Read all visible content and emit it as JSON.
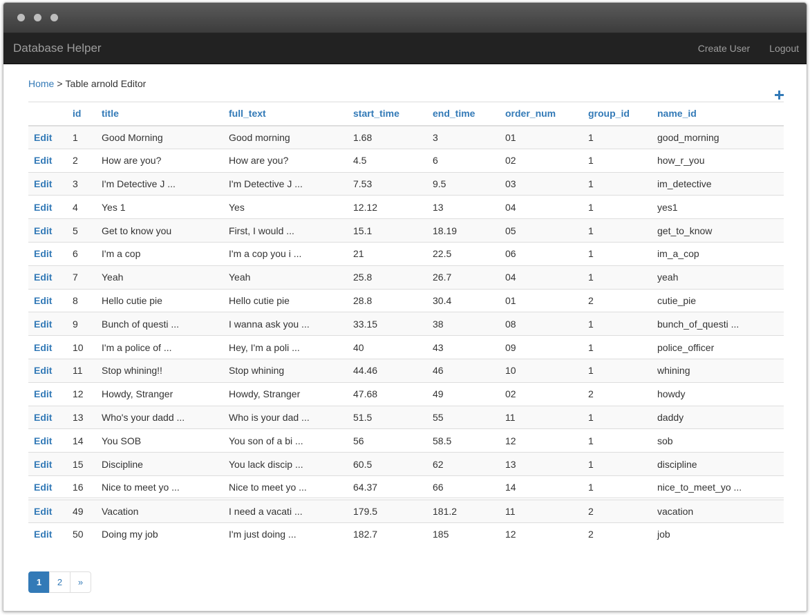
{
  "navbar": {
    "brand": "Database Helper",
    "links": [
      "Create User",
      "Logout"
    ]
  },
  "breadcrumb": {
    "home": "Home",
    "separator": ">",
    "current": "Table arnold Editor"
  },
  "table": {
    "columns": [
      "",
      "id",
      "title",
      "full_text",
      "start_time",
      "end_time",
      "order_num",
      "group_id",
      "name_id"
    ],
    "edit_label": "Edit",
    "rows": [
      [
        "1",
        "Good Morning",
        "Good morning",
        "1.68",
        "3",
        "01",
        "1",
        "good_morning"
      ],
      [
        "2",
        "How are you?",
        "How are you?",
        "4.5",
        "6",
        "02",
        "1",
        "how_r_you"
      ],
      [
        "3",
        "I'm Detective J ...",
        "I'm Detective J ...",
        "7.53",
        "9.5",
        "03",
        "1",
        "im_detective"
      ],
      [
        "4",
        "Yes 1",
        "Yes",
        "12.12",
        "13",
        "04",
        "1",
        "yes1"
      ],
      [
        "5",
        "Get to know you",
        "First, I would ...",
        "15.1",
        "18.19",
        "05",
        "1",
        "get_to_know"
      ],
      [
        "6",
        "I'm a cop",
        "I'm a cop you i ...",
        "21",
        "22.5",
        "06",
        "1",
        "im_a_cop"
      ],
      [
        "7",
        "Yeah",
        "Yeah",
        "25.8",
        "26.7",
        "04",
        "1",
        "yeah"
      ],
      [
        "8",
        "Hello cutie pie",
        "Hello cutie pie",
        "28.8",
        "30.4",
        "01",
        "2",
        "cutie_pie"
      ],
      [
        "9",
        "Bunch of questi ...",
        "I wanna ask you ...",
        "33.15",
        "38",
        "08",
        "1",
        "bunch_of_questi ..."
      ],
      [
        "10",
        "I'm a police of ...",
        "Hey, I'm a poli ...",
        "40",
        "43",
        "09",
        "1",
        "police_officer"
      ],
      [
        "11",
        "Stop whining!!",
        "Stop whining",
        "44.46",
        "46",
        "10",
        "1",
        "whining"
      ],
      [
        "12",
        "Howdy, Stranger",
        "Howdy, Stranger",
        "47.68",
        "49",
        "02",
        "2",
        "howdy"
      ],
      [
        "13",
        "Who's your dadd ...",
        "Who is your dad ...",
        "51.5",
        "55",
        "11",
        "1",
        "daddy"
      ],
      [
        "14",
        "You SOB",
        "You son of a bi ...",
        "56",
        "58.5",
        "12",
        "1",
        "sob"
      ],
      [
        "15",
        "Discipline",
        "You lack discip ...",
        "60.5",
        "62",
        "13",
        "1",
        "discipline"
      ],
      [
        "16",
        "Nice to meet yo ...",
        "Nice to meet yo ...",
        "64.37",
        "66",
        "14",
        "1",
        "nice_to_meet_yo ..."
      ],
      [
        "49",
        "Vacation",
        "I need a vacati ...",
        "179.5",
        "181.2",
        "11",
        "2",
        "vacation"
      ],
      [
        "50",
        "Doing my job",
        "I'm just doing ...",
        "182.7",
        "185",
        "12",
        "2",
        "job"
      ]
    ]
  },
  "pagination": {
    "pages": [
      "1",
      "2",
      "»"
    ],
    "active": "1"
  },
  "colors": {
    "accent": "#337ab7",
    "navbar_bg": "#222222",
    "navbar_text": "#9d9d9d"
  }
}
